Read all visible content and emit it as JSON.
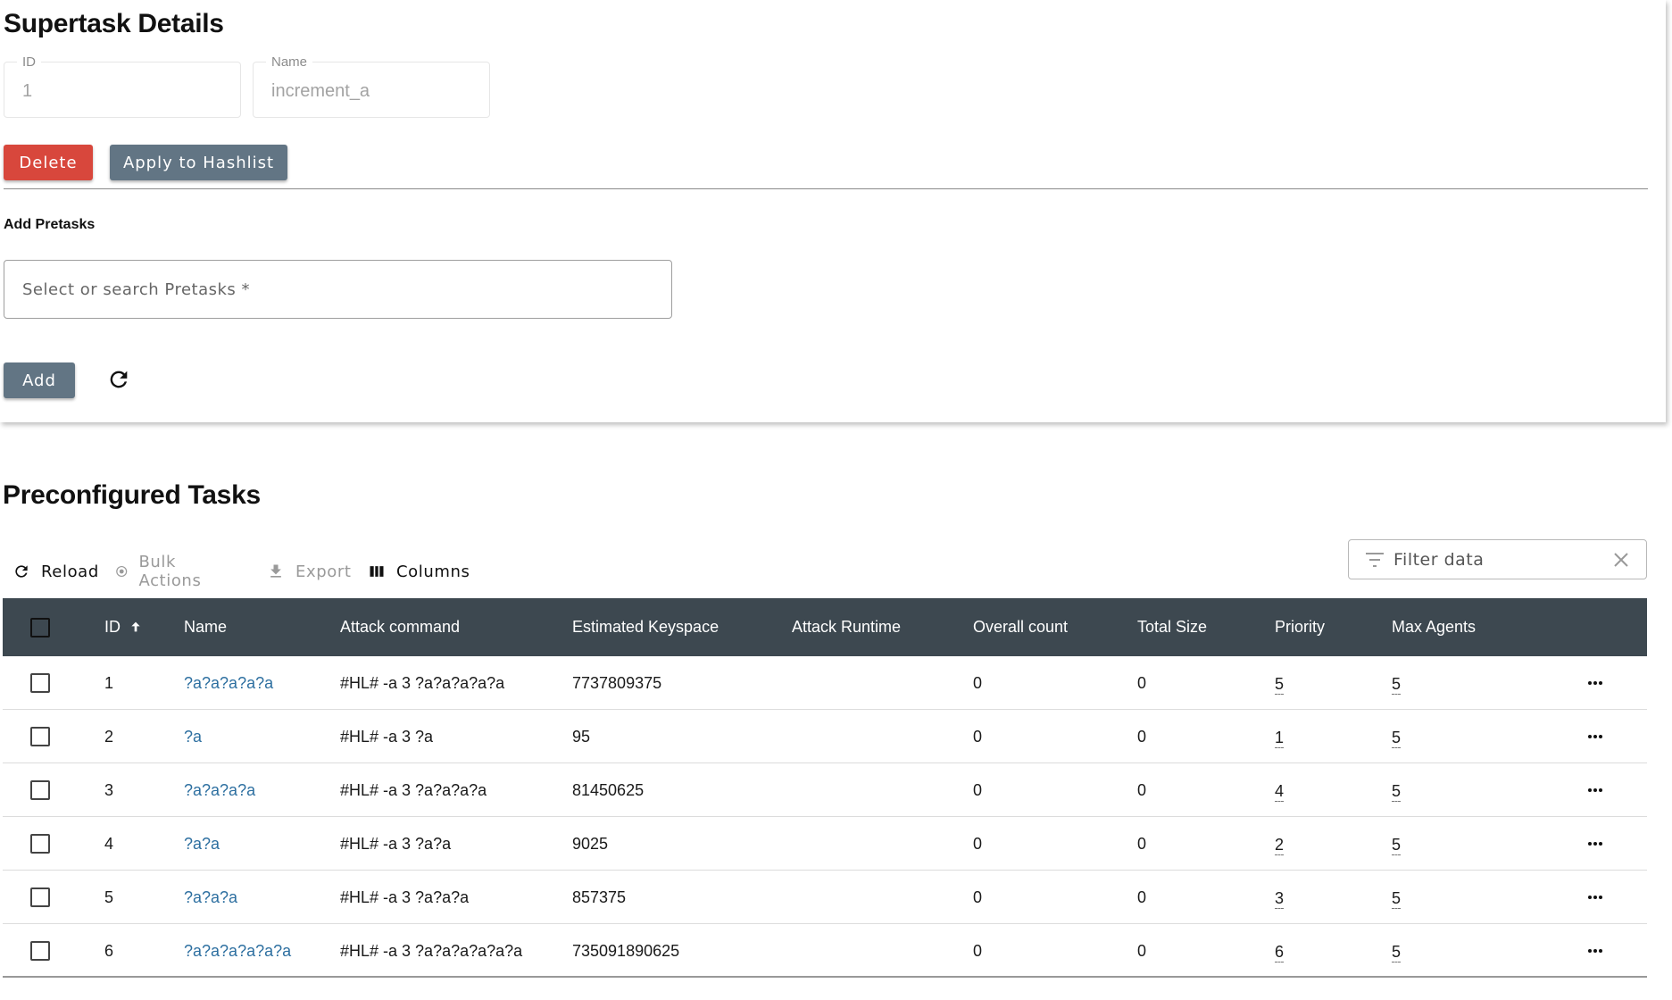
{
  "details": {
    "title": "Supertask Details",
    "id_label": "ID",
    "id_value": "1",
    "name_label": "Name",
    "name_value": "increment_a",
    "delete_label": "Delete",
    "apply_label": "Apply to Hashlist",
    "add_pretasks_title": "Add Pretasks",
    "pretask_placeholder": "Select or search Pretasks *",
    "add_label": "Add",
    "delete_color": "#d8473c",
    "button_color": "#627584"
  },
  "tasks": {
    "title": "Preconfigured Tasks",
    "toolbar": {
      "reload": "Reload",
      "bulk_actions": "Bulk Actions",
      "export": "Export",
      "columns": "Columns"
    },
    "filter_placeholder": "Filter data",
    "columns": [
      "ID",
      "Name",
      "Attack command",
      "Estimated Keyspace",
      "Attack Runtime",
      "Overall count",
      "Total Size",
      "Priority",
      "Max Agents"
    ],
    "header_color": "#3d4850",
    "link_color": "#2d6fa0",
    "rows": [
      {
        "id": "1",
        "name": "?a?a?a?a?a",
        "attack": "#HL# -a 3 ?a?a?a?a?a",
        "keyspace": "7737809375",
        "runtime": "",
        "count": "0",
        "size": "0",
        "priority": "5",
        "max_agents": "5"
      },
      {
        "id": "2",
        "name": "?a",
        "attack": "#HL# -a 3 ?a",
        "keyspace": "95",
        "runtime": "",
        "count": "0",
        "size": "0",
        "priority": "1",
        "max_agents": "5"
      },
      {
        "id": "3",
        "name": "?a?a?a?a",
        "attack": "#HL# -a 3 ?a?a?a?a",
        "keyspace": "81450625",
        "runtime": "",
        "count": "0",
        "size": "0",
        "priority": "4",
        "max_agents": "5"
      },
      {
        "id": "4",
        "name": "?a?a",
        "attack": "#HL# -a 3 ?a?a",
        "keyspace": "9025",
        "runtime": "",
        "count": "0",
        "size": "0",
        "priority": "2",
        "max_agents": "5"
      },
      {
        "id": "5",
        "name": "?a?a?a",
        "attack": "#HL# -a 3 ?a?a?a",
        "keyspace": "857375",
        "runtime": "",
        "count": "0",
        "size": "0",
        "priority": "3",
        "max_agents": "5"
      },
      {
        "id": "6",
        "name": "?a?a?a?a?a?a",
        "attack": "#HL# -a 3 ?a?a?a?a?a?a",
        "keyspace": "735091890625",
        "runtime": "",
        "count": "0",
        "size": "0",
        "priority": "6",
        "max_agents": "5"
      }
    ]
  }
}
